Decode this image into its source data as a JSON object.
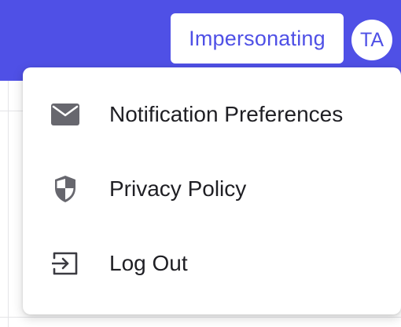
{
  "header": {
    "impersonating_label": "Impersonating",
    "avatar_initials": "TA",
    "brand_color": "#4f50e6"
  },
  "menu": {
    "items": [
      {
        "label": "Notification Preferences",
        "icon": "envelope-icon"
      },
      {
        "label": "Privacy Policy",
        "icon": "shield-icon"
      },
      {
        "label": "Log Out",
        "icon": "log-out-icon"
      }
    ]
  }
}
